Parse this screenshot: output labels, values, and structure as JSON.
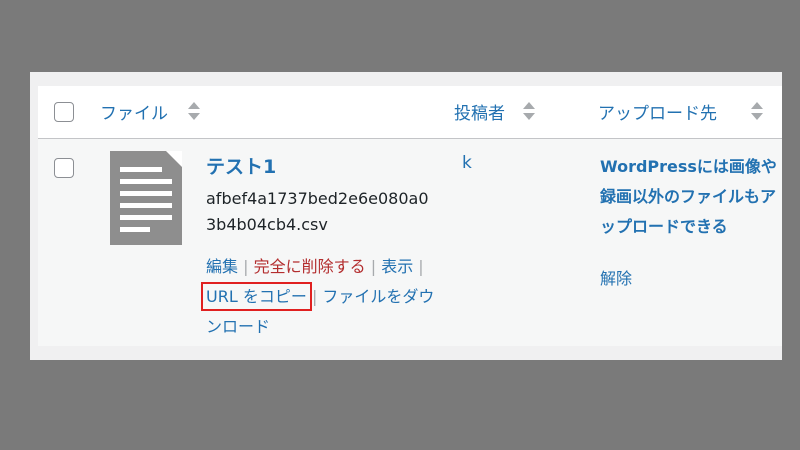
{
  "header": {
    "file_label": "ファイル",
    "author_label": "投稿者",
    "uploaded_to_label": "アップロード先"
  },
  "row": {
    "title": "テスト1",
    "filename": "afbef4a1737bed2e6e080a03b4b04cb4.csv",
    "actions": {
      "edit": "編集",
      "delete": "完全に削除する",
      "view": "表示",
      "copy_url": "URL をコピー",
      "download": "ファイルをダウンロード",
      "separator": "|"
    },
    "author": "k",
    "uploaded_to": "WordPressには画像や録画以外のファイルもアップロードできる",
    "detach": "解除"
  },
  "colors": {
    "link": "#2271b1",
    "delete": "#b32d2e",
    "highlight": "#e02020",
    "background": "#7a7a7a"
  },
  "icons": [
    "checkbox",
    "sort-icon",
    "document-icon"
  ]
}
